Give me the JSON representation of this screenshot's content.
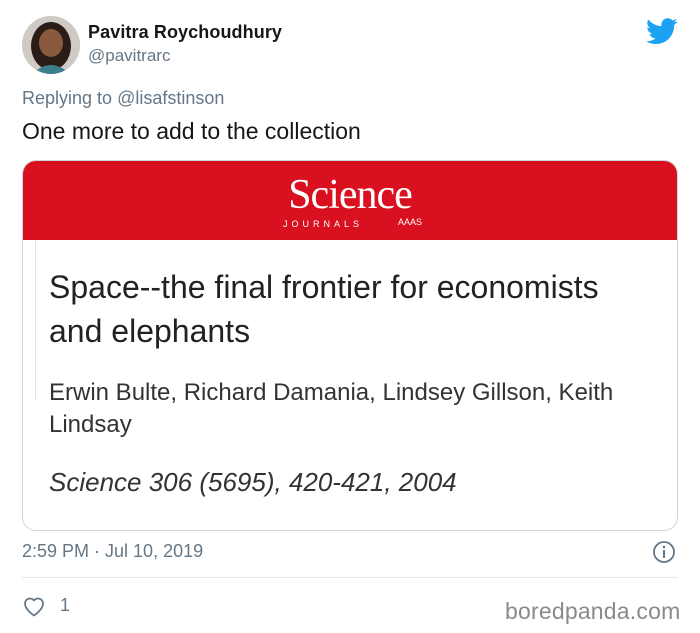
{
  "tweet": {
    "display_name": "Pavitra Roychoudhury",
    "handle": "@pavitrarc",
    "replying_prefix": "Replying to ",
    "replying_to": "@lisafstinson",
    "text": "One more to add to the collection",
    "timestamp": "2:59 PM · Jul 10, 2019",
    "like_count": "1"
  },
  "card": {
    "logo": "Science",
    "logo_sub": "JOURNALS",
    "logo_aaas": "AAAS",
    "title": "Space--the final frontier for economists and elephants",
    "authors": "Erwin Bulte, Richard Damania, Lindsey Gillson, Keith Lindsay",
    "citation": "Science 306 (5695), 420-421, 2004"
  },
  "watermark": "boredpanda.com",
  "colors": {
    "science_red": "#d8101f",
    "twitter_blue": "#1da1f2",
    "secondary_text": "#657786"
  },
  "icons": {
    "brand": "twitter-bird-icon",
    "info": "info-icon",
    "like": "heart-icon"
  }
}
